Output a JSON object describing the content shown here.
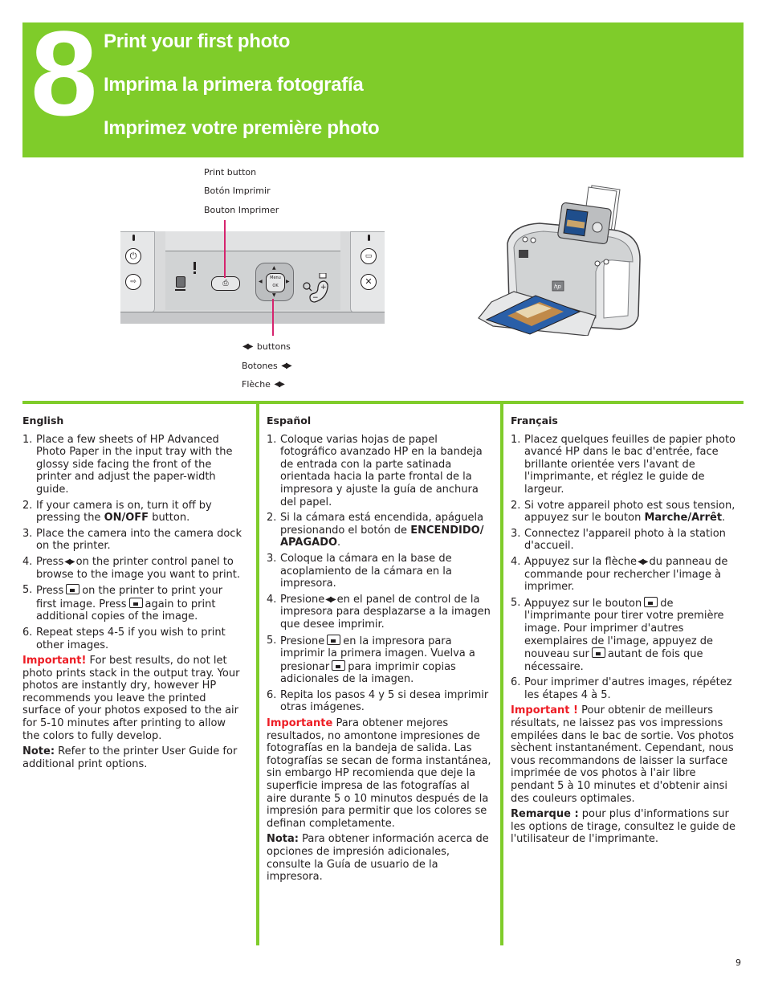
{
  "banner": {
    "step_number": "8",
    "titles": [
      "Print your first photo",
      "Imprima la primera fotografía",
      "Imprimez votre première photo"
    ],
    "color": "#7fcc2a"
  },
  "figure": {
    "print_button_callouts": [
      "Print button",
      "Botón Imprimir",
      "Bouton Imprimer"
    ],
    "arrow_button_callouts": {
      "en": "buttons",
      "es": "Botones",
      "fr": "Flèche"
    },
    "panel": {
      "dpad_label_top": "Menu",
      "dpad_label_bottom": "OK",
      "zoom_plus": "+",
      "zoom_minus": "−"
    },
    "leader_color": "#d6246e"
  },
  "columns": {
    "en": {
      "heading": "English",
      "steps": [
        {
          "num": "1.",
          "parts": [
            "Place a few sheets of HP Advanced Photo Paper in the input tray with the glossy side facing the front of the printer and adjust the paper-width guide."
          ]
        },
        {
          "num": "2.",
          "pre": "If your camera is on, turn it off by pressing the ",
          "bold": "ON/OFF",
          "post": " button."
        },
        {
          "num": "3.",
          "parts": [
            "Place the camera into the camera dock on the printer."
          ]
        },
        {
          "num": "4.",
          "pre": "Press",
          "post": "on the printer control panel to browse to the image you want to print."
        },
        {
          "num": "5.",
          "pre": "Press",
          "mid": "on the printer to print your first image. Press",
          "post": "again to print additional copies of the image."
        },
        {
          "num": "6.",
          "parts": [
            "Repeat steps 4-5 if you wish to print other images."
          ]
        }
      ],
      "important_label": "Important!",
      "important_text": " For best results, do not let photo prints stack in the output tray. Your photos are instantly dry, however HP recommends you leave the printed surface of your photos exposed to the air for 5-10 minutes after printing to allow the colors to fully develop.",
      "note_label": "Note:",
      "note_text": " Refer to the printer User Guide for additional print options."
    },
    "es": {
      "heading": "Español",
      "steps": [
        {
          "num": "1.",
          "parts": [
            "Coloque varias hojas de papel fotográfico avanzado HP en la bandeja de entrada con la parte satinada orientada hacia la parte frontal de la impresora y ajuste la guía de anchura del papel."
          ]
        },
        {
          "num": "2.",
          "pre": "Si la cámara está encendida, apáguela presionando el botón de ",
          "bold": "ENCENDIDO/ APAGADO",
          "post": "."
        },
        {
          "num": "3.",
          "parts": [
            "Coloque la cámara en la base de acoplamiento de la cámara en la impresora."
          ]
        },
        {
          "num": "4.",
          "pre": "Presione",
          "post": "en el panel de control de la impresora para desplazarse a la imagen que desee imprimir."
        },
        {
          "num": "5.",
          "pre": "Presione",
          "mid": "en la impresora para imprimir la primera imagen. Vuelva a presionar",
          "post": "para imprimir copias adicionales de la imagen."
        },
        {
          "num": "6.",
          "parts": [
            "Repita los pasos 4 y 5 si desea imprimir otras imágenes."
          ]
        }
      ],
      "important_label": "Importante",
      "important_text": " Para obtener mejores resultados, no amontone impresiones de fotografías en la bandeja de salida. Las fotografías se secan de forma instantánea, sin embargo HP recomienda que deje la superficie impresa de las fotografías al aire durante 5 o 10 minutos después de la impresión para permitir que los colores se definan completamente.",
      "note_label": "Nota:",
      "note_text": " Para obtener información acerca de opciones de impresión adicionales, consulte la Guía de usuario de la impresora."
    },
    "fr": {
      "heading": "Français",
      "steps": [
        {
          "num": "1.",
          "parts": [
            "Placez quelques feuilles de papier photo avancé HP dans le bac d'entrée, face brillante orientée vers l'avant de l'imprimante, et réglez le guide de largeur."
          ]
        },
        {
          "num": "2.",
          "pre": "Si votre appareil photo est sous tension, appuyez sur le bouton ",
          "bold": "Marche/Arrêt",
          "post": "."
        },
        {
          "num": "3.",
          "parts": [
            "Connectez l'appareil photo à la station d'accueil."
          ]
        },
        {
          "num": "4.",
          "pre": "Appuyez sur la flèche",
          "post": "du panneau de commande pour rechercher l'image à imprimer."
        },
        {
          "num": "5.",
          "pre": "Appuyez sur le bouton",
          "mid": "de l'imprimante pour tirer votre première image. Pour imprimer d'autres exemplaires de l'image, appuyez de nouveau sur",
          "post": "autant de fois que nécessaire."
        },
        {
          "num": "6.",
          "parts": [
            "Pour imprimer d'autres images, répétez les étapes 4 à 5."
          ]
        }
      ],
      "important_label": "Important !",
      "important_text": " Pour obtenir de meilleurs résultats, ne laissez pas vos impressions empilées dans le bac de sortie. Vos photos sèchent instantanément. Cependant, nous vous recommandons de laisser la surface imprimée de vos photos à l'air libre pendant 5 à 10 minutes et d'obtenir ainsi des couleurs optimales.",
      "note_label": "Remarque :",
      "note_text": " pour plus d'informations sur les options de tirage, consultez le guide de l'utilisateur de l'imprimante."
    }
  },
  "footer": {
    "page_number": "9"
  }
}
